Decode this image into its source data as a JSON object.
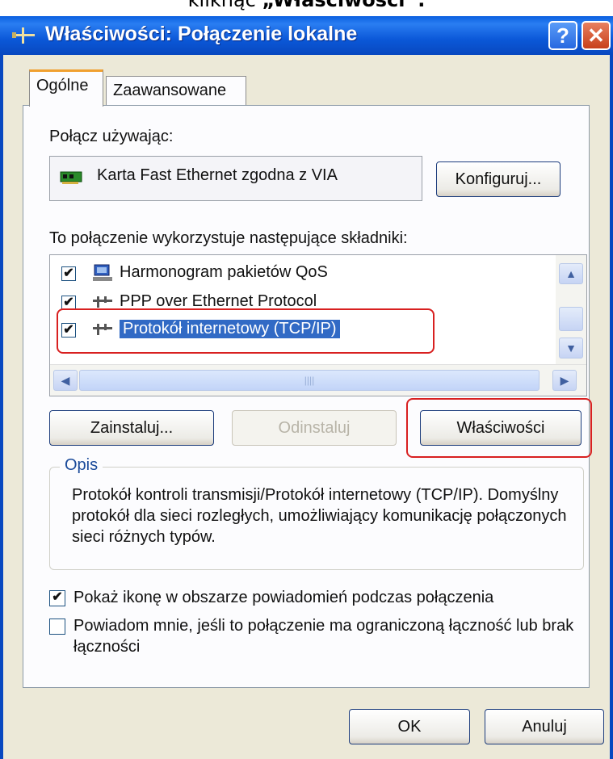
{
  "caption": {
    "prefix": "kliknąć ",
    "bold": "„Właściwości”."
  },
  "window": {
    "title": "Właściwości: Połączenie lokalne",
    "help_label": "?",
    "close_label": "✕"
  },
  "tabs": [
    {
      "label": "Ogólne"
    },
    {
      "label": "Zaawansowane"
    }
  ],
  "connect_using": {
    "label": "Połącz używając:",
    "adapter": "Karta Fast Ethernet zgodna z VIA",
    "configure_button": "Konfiguruj..."
  },
  "components": {
    "label": "To połączenie wykorzystuje następujące składniki:",
    "items": [
      {
        "label": "Harmonogram pakietów QoS",
        "checked": true,
        "icon": "qos-scheduler-icon"
      },
      {
        "label": "PPP over Ethernet Protocol",
        "checked": true,
        "icon": "network-protocol-icon"
      },
      {
        "label": "Protokół internetowy (TCP/IP)",
        "checked": true,
        "selected": true,
        "icon": "network-protocol-icon"
      }
    ],
    "scroll_up": "▲",
    "scroll_down": "▼",
    "scroll_left": "◀",
    "scroll_right": "▶",
    "thumb_grip": "||||"
  },
  "buttons": {
    "install": "Zainstaluj...",
    "uninstall": "Odinstaluj",
    "properties": "Właściwości",
    "ok": "OK",
    "cancel": "Anuluj"
  },
  "description": {
    "legend": "Opis",
    "text": "Protokół kontroli transmisji/Protokół internetowy (TCP/IP). Domyślny protokół dla sieci rozległych, umożliwiający komunikację połączonych sieci różnych typów."
  },
  "options": {
    "show_icon": {
      "label": "Pokaż ikonę w obszarze powiadomień podczas połączenia",
      "checked": true
    },
    "notify_limited": {
      "label": "Powiadom mnie, jeśli to połączenie ma ograniczoną łączność lub brak łączności",
      "checked": false
    }
  },
  "check_mark": "✔",
  "colors": {
    "title_bar": "#0a5fe0",
    "selection": "#316ac5",
    "highlight_ring": "#d82020",
    "dialog_bg": "#ece9d8"
  }
}
